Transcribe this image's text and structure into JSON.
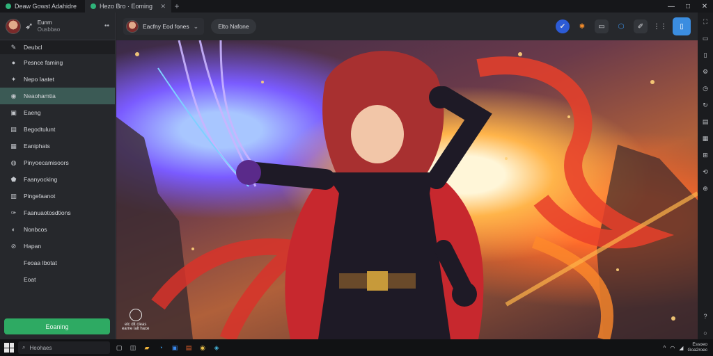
{
  "tabs": [
    {
      "label": "Deaw Gowst Adahidre"
    },
    {
      "label": "Hezo Bro · Eoming"
    }
  ],
  "window": {
    "minimize": "—",
    "maximize": "□",
    "close": "✕"
  },
  "sidebar": {
    "profile": {
      "name": "Eunm",
      "sub": "Ousbbao"
    },
    "more": "••",
    "items": [
      {
        "label": "Deubcl",
        "icon": "wrench-icon",
        "glyph": "✎"
      },
      {
        "label": "Pesnce faming",
        "icon": "avatar-icon",
        "glyph": "●"
      },
      {
        "label": "Nepo Iaatet",
        "icon": "game-icon",
        "glyph": "✦"
      },
      {
        "label": "Neaohamtia",
        "icon": "circle-icon",
        "glyph": "◉"
      },
      {
        "label": "Eaeng",
        "icon": "badge-icon",
        "glyph": "▣"
      },
      {
        "label": "Begodtulunt",
        "icon": "folder-icon",
        "glyph": "▤"
      },
      {
        "label": "Eaniphats",
        "icon": "grid-icon",
        "glyph": "▦"
      },
      {
        "label": "Pinyoecamisoors",
        "icon": "chat-icon",
        "glyph": "◍"
      },
      {
        "label": "Faanyocking",
        "icon": "shield-icon",
        "glyph": "⬟"
      },
      {
        "label": "Pingefaanot",
        "icon": "image-icon",
        "glyph": "▥"
      },
      {
        "label": "Faanuaotosdtions",
        "icon": "pen-icon",
        "glyph": "✑"
      },
      {
        "label": "Nonbcos",
        "icon": "globe-icon",
        "glyph": "◐"
      },
      {
        "label": "Hapan",
        "icon": "link-icon",
        "glyph": "⊘"
      },
      {
        "label": "Feoaa Ibotat",
        "icon": "",
        "glyph": ""
      },
      {
        "label": "Eoat",
        "icon": "",
        "glyph": ""
      }
    ],
    "cta_label": "Eoaning"
  },
  "toolbar": {
    "selector_label": "Eacfny Eod fones",
    "pill_label": "Elto Nafone",
    "tools": [
      {
        "icon": "shield-check-icon",
        "glyph": "✔"
      },
      {
        "icon": "sparkle-icon",
        "glyph": "✱"
      },
      {
        "icon": "camera-icon",
        "glyph": "▭"
      },
      {
        "icon": "badge-blue-icon",
        "glyph": "⬡"
      },
      {
        "icon": "edit-icon",
        "glyph": "✐"
      },
      {
        "icon": "apps-icon",
        "glyph": "⋮⋮"
      },
      {
        "icon": "phone-icon",
        "glyph": "▯"
      }
    ]
  },
  "watermark": {
    "line1": "elc dlt cleas",
    "line2": "earne lalt hace"
  },
  "taskbar": {
    "search_placeholder": "Heohaes",
    "time": "Essoeo",
    "date": "Goa2roec"
  },
  "colors": {
    "accent_green": "#2eaa63",
    "active_item": "#3b5a55",
    "primary_blue": "#3b8de0"
  }
}
